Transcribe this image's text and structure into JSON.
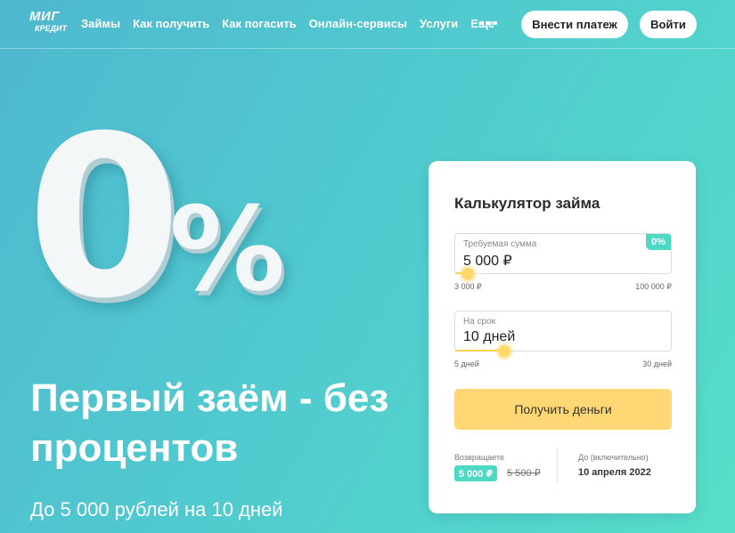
{
  "header": {
    "logo_top": "МИГ",
    "logo_bottom": "КРЕДИТ",
    "nav": [
      "Займы",
      "Как получить",
      "Как погасить",
      "Онлайн-сервисы",
      "Услуги",
      "Еще"
    ],
    "more_icon": "•••",
    "pay_button": "Внести платеж",
    "login_button": "Войти"
  },
  "hero": {
    "graphic_zero": "0",
    "graphic_percent": "%",
    "title": "Первый заём - без процентов",
    "subtitle": "До 5 000 рублей на 10 дней"
  },
  "calculator": {
    "title": "Калькулятор займа",
    "amount": {
      "label": "Требуемая сумма",
      "value": "5 000 ₽",
      "badge": "0%",
      "min": "3 000 ₽",
      "max": "100 000 ₽",
      "level": 0.02
    },
    "term": {
      "label": "На срок",
      "value": "10 дней",
      "min": "5 дней",
      "max": "30 дней",
      "level": 0.2
    },
    "submit": "Получить деньги",
    "return_label": "Возвращаете",
    "return_amount": "5 000 ₽",
    "old_amount": "5 500 ₽",
    "until_label": "До (включительно)",
    "until_date": "10 апреля 2022"
  },
  "colors": {
    "accent": "#4dd9c4",
    "button": "#ffd875",
    "slider": "#ffd86a"
  }
}
